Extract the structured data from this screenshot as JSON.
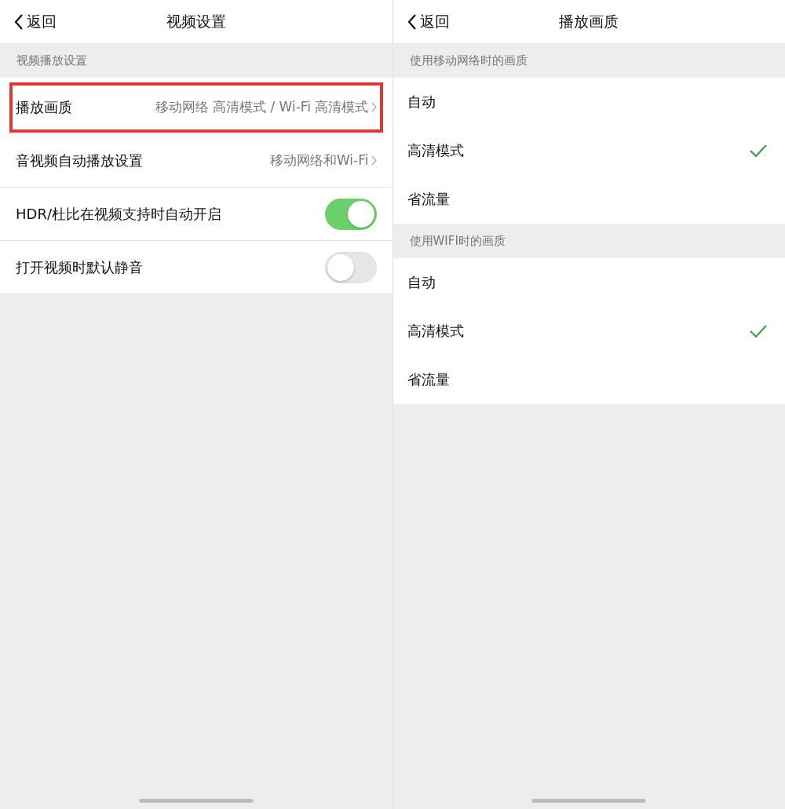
{
  "left": {
    "back": "返回",
    "title": "视频设置",
    "section": "视频播放设置",
    "rows": [
      {
        "kind": "link",
        "label": "播放画质",
        "value": "移动网络 高清模式 / Wi-Fi 高清模式",
        "highlighted": true
      },
      {
        "kind": "link",
        "label": "音视频自动播放设置",
        "value": "移动网络和Wi-Fi",
        "highlighted": false
      },
      {
        "kind": "toggle",
        "label": "HDR/杜比在视频支持时自动开启",
        "on": true
      },
      {
        "kind": "toggle",
        "label": "打开视频时默认静音",
        "on": false
      }
    ]
  },
  "right": {
    "back": "返回",
    "title": "播放画质",
    "groups": [
      {
        "label": "使用移动网络时的画质",
        "options": [
          {
            "label": "自动",
            "selected": false
          },
          {
            "label": "高清模式",
            "selected": true
          },
          {
            "label": "省流量",
            "selected": false
          }
        ]
      },
      {
        "label": "使用WIFI时的画质",
        "options": [
          {
            "label": "自动",
            "selected": false
          },
          {
            "label": "高清模式",
            "selected": true
          },
          {
            "label": "省流量",
            "selected": false
          }
        ]
      }
    ]
  }
}
